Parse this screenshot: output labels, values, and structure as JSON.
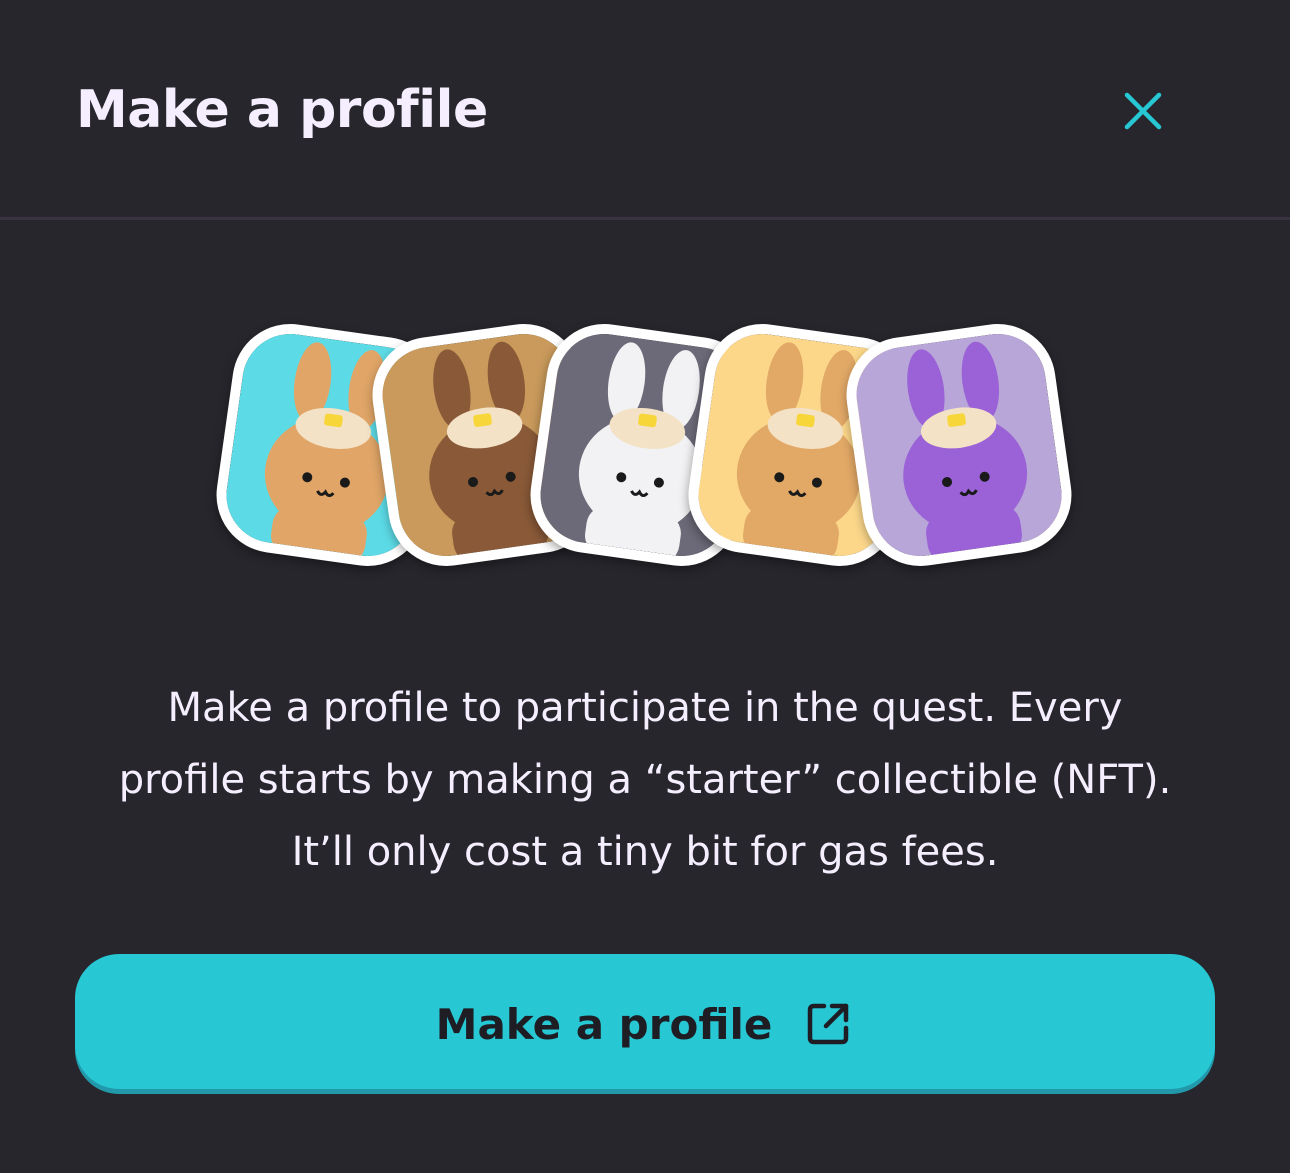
{
  "modal": {
    "title": "Make a profile",
    "close_icon": "close-icon",
    "description_lines": [
      "Make a profile to participate in the quest. Every",
      "profile starts by making a “starter” collectible (NFT).",
      "It’ll only cost a tiny bit for gas fees."
    ],
    "cta": {
      "label": "Make a profile",
      "icon": "external-link-icon"
    },
    "avatars": [
      {
        "name": "bunny-orange-on-cyan",
        "background": "#5cdbe6",
        "bunny": "#e0a567"
      },
      {
        "name": "bunny-brown-on-tan",
        "background": "#c99a5b",
        "bunny": "#8a5a38"
      },
      {
        "name": "bunny-white-on-grey",
        "background": "#6c6a78",
        "bunny": "#f2f2f4"
      },
      {
        "name": "bunny-orange-on-yellow",
        "background": "#fcd78a",
        "bunny": "#e2a866"
      },
      {
        "name": "bunny-purple-on-lavender",
        "background": "#b9a6d8",
        "bunny": "#9a62d6"
      }
    ]
  },
  "colors": {
    "background": "#27262c",
    "title_text": "#f4eeff",
    "accent": "#27c7d4",
    "close_icon": "#27c7d4",
    "cta_text": "#1e1d24",
    "divider": "#383241"
  }
}
